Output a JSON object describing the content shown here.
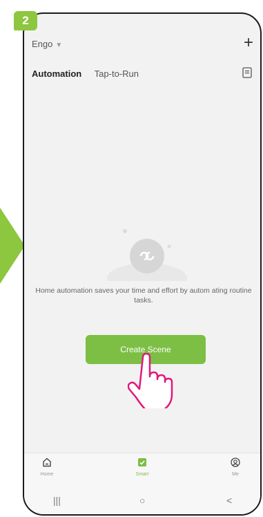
{
  "step": {
    "number": "2"
  },
  "colors": {
    "accent": "#7cbf44",
    "badge": "#8dc63f",
    "hand": "#e0197d"
  },
  "header": {
    "home_name": "Engo",
    "add_icon": "plus-icon"
  },
  "tabs": [
    {
      "label": "Automation",
      "active": true
    },
    {
      "label": "Tap-to-Run",
      "active": false
    }
  ],
  "empty_state": {
    "message": "Home automation saves your time and effort by autom ating routine tasks.",
    "button_label": "Create Scene"
  },
  "bottom_nav": [
    {
      "label": "Home",
      "icon": "home-icon"
    },
    {
      "label": "Smart",
      "icon": "smart-icon",
      "active": true
    },
    {
      "label": "Me",
      "icon": "profile-icon"
    }
  ],
  "system_nav": {
    "recents": "|||",
    "home": "○",
    "back": "<"
  }
}
